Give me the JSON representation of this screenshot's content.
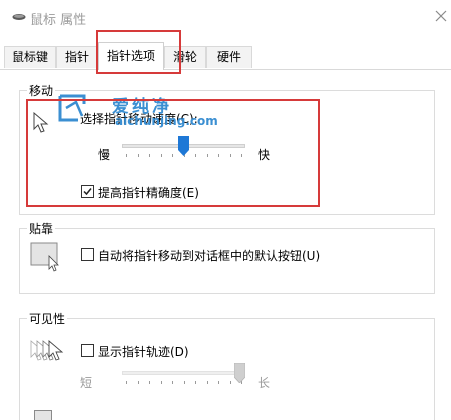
{
  "window": {
    "title": "鼠标 属性",
    "close_icon": "close-x-icon"
  },
  "tabs": [
    {
      "label": "鼠标键",
      "active": false
    },
    {
      "label": "指针",
      "active": false
    },
    {
      "label": "指针选项",
      "active": true
    },
    {
      "label": "滑轮",
      "active": false
    },
    {
      "label": "硬件",
      "active": false
    }
  ],
  "motion": {
    "group_title": "移动",
    "speed_label": "选择指针移动速度(C):",
    "slow_label": "慢",
    "fast_label": "快",
    "speed_level": 0.5,
    "precision_label": "提高指针精确度(E)",
    "precision_checked": true
  },
  "snap": {
    "group_title": "贴靠",
    "snap_label": "自动将指针移动到对话框中的默认按钮(U)",
    "snap_checked": false
  },
  "visibility": {
    "group_title": "可见性",
    "trails_label": "显示指针轨迹(D)",
    "trails_checked": false,
    "short_label": "短",
    "long_label": "长",
    "trail_level": 1.0
  },
  "watermark": {
    "name": "爱纯净",
    "url": "aichunjing.com"
  },
  "colors": {
    "highlight": "#d63a3a",
    "slider_thumb": "#1e78d6",
    "watermark": "#3b8fd2"
  }
}
